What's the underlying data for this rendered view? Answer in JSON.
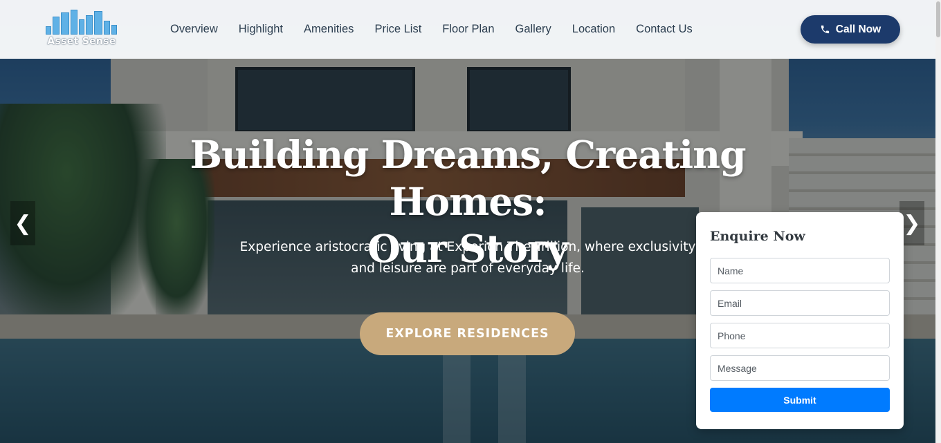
{
  "brand": {
    "name": "Asset Sense"
  },
  "nav": {
    "items": [
      {
        "label": "Overview"
      },
      {
        "label": "Highlight"
      },
      {
        "label": "Amenities"
      },
      {
        "label": "Price List"
      },
      {
        "label": "Floor Plan"
      },
      {
        "label": "Gallery"
      },
      {
        "label": "Location"
      },
      {
        "label": "Contact Us"
      }
    ],
    "call_label": "Call Now"
  },
  "hero": {
    "title_line1": "Building Dreams, Creating Homes:",
    "title_line2": "Our Story",
    "subtitle_line1": "Experience aristocratic living at Experion The Trillion, where exclusivity",
    "subtitle_line2": "and leisure are part of everyday life.",
    "cta_label": "EXPLORE RESIDENCES",
    "prev_arrow": "❮",
    "next_arrow": "❯"
  },
  "enquiry": {
    "title": "Enquire Now",
    "name_placeholder": "Name",
    "email_placeholder": "Email",
    "phone_placeholder": "Phone",
    "message_placeholder": "Message",
    "submit_label": "Submit"
  },
  "colors": {
    "call_button": "#1c3a6b",
    "cta_button": "#c8a97c",
    "submit_button": "#007bff",
    "nav_text": "#2c3e50"
  },
  "icons": {
    "call": "phone-icon",
    "prev": "chevron-left-icon",
    "next": "chevron-right-icon"
  }
}
